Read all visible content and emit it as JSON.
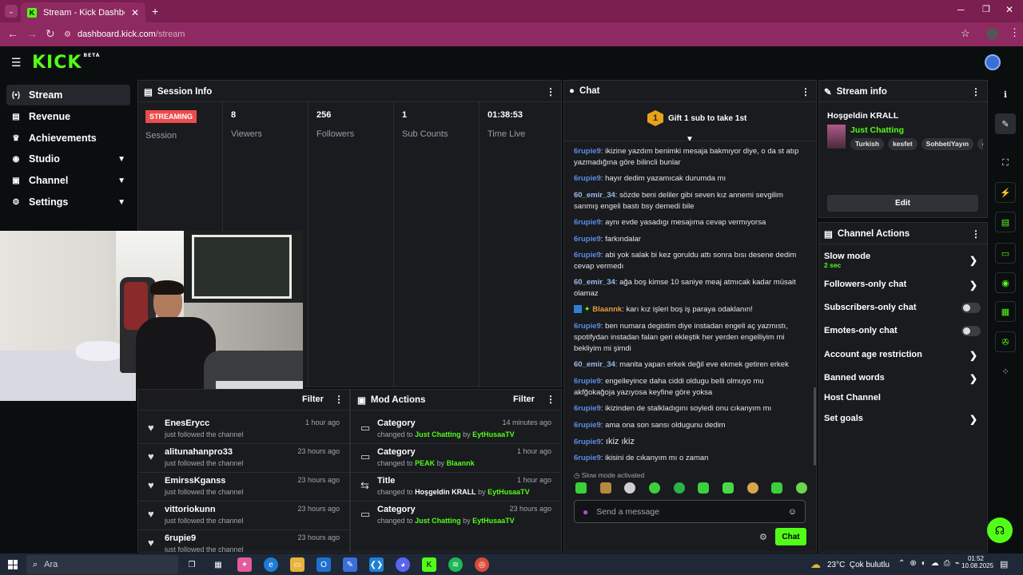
{
  "browser": {
    "tab_title": "Stream - Kick Dashboard",
    "url_host": "dashboard.kick.com",
    "url_path": "/stream"
  },
  "brand": {
    "logo": "KICK",
    "logo_sup": "BETA",
    "accent": "#53fc18"
  },
  "sidebar": {
    "items": [
      {
        "label": "Stream",
        "icon": "broadcast-icon"
      },
      {
        "label": "Revenue",
        "icon": "wallet-icon"
      },
      {
        "label": "Achievements",
        "icon": "trophy-icon"
      },
      {
        "label": "Studio",
        "icon": "studio-icon"
      },
      {
        "label": "Channel",
        "icon": "channel-icon"
      },
      {
        "label": "Settings",
        "icon": "gear-icon"
      }
    ]
  },
  "session": {
    "title": "Session Info",
    "status": "STREAMING",
    "status_label": "Session",
    "stats": [
      {
        "value": "8",
        "label": "Viewers"
      },
      {
        "value": "256",
        "label": "Followers"
      },
      {
        "value": "1",
        "label": "Sub Counts"
      },
      {
        "value": "01:38:53",
        "label": "Time Live"
      }
    ]
  },
  "followers": {
    "filter": "Filter",
    "rows": [
      {
        "name": "EnesErycc",
        "sub": "just followed the channel",
        "time": "1 hour ago"
      },
      {
        "name": "alitunahanpro33",
        "sub": "just followed the channel",
        "time": "23 hours ago"
      },
      {
        "name": "EmirssKganss",
        "sub": "just followed the channel",
        "time": "23 hours ago"
      },
      {
        "name": "vittoriokunn",
        "sub": "just followed the channel",
        "time": "23 hours ago"
      },
      {
        "name": "6rupie9",
        "sub": "just followed the channel",
        "time": "23 hours ago"
      }
    ]
  },
  "mod_actions": {
    "title": "Mod Actions",
    "filter": "Filter",
    "rows": [
      {
        "name": "Category",
        "pre": "changed to",
        "value": "Just Chatting",
        "by": "by",
        "who": "EytHusaaTV",
        "time": "14 minutes ago",
        "value_green": true
      },
      {
        "name": "Category",
        "pre": "changed to",
        "value": "PEAK",
        "by": "by",
        "who": "Blaannk",
        "time": "1 hour ago",
        "value_green": true
      },
      {
        "name": "Title",
        "pre": "changed to",
        "value": "Hoşgeldin KRALL",
        "by": "by",
        "who": "EytHusaaTV",
        "time": "1 hour ago",
        "value_green": false
      },
      {
        "name": "Category",
        "pre": "changed to",
        "value": "Just Chatting",
        "by": "by",
        "who": "EytHusaaTV",
        "time": "23 hours ago",
        "value_green": true
      }
    ]
  },
  "chat": {
    "title": "Chat",
    "gift_text": "Gift 1 sub to take 1st",
    "gift_rank": "1",
    "messages": [
      {
        "user": "6rupie9",
        "text": "ikizine yazdım benimki mesaja bakmıyor diye, o da st atıp yazmadığına göre bilincli bunlar"
      },
      {
        "user": "6rupie9",
        "text": "hayır dedim yazamıcak durumda mı"
      },
      {
        "user": "60_emir_34",
        "text": "sözde beni deliler gibi seven kız annemi sevgilim sanmış engeli bastı bsy demedi bile"
      },
      {
        "user": "6rupie9",
        "text": "aynı evde yasadıgı mesajıma cevap vermıyorsa"
      },
      {
        "user": "6rupie9",
        "text": "farkındalar"
      },
      {
        "user": "6rupie9",
        "text": "abi yok salak bi kez goruldu attı sonra bısı desene dedim cevap vermedı"
      },
      {
        "user": "60_emir_34",
        "text": "ağa boş kimse 10 saniye meaj atmıcak kadar müsait olamaz"
      },
      {
        "user": "Blaannk",
        "text": "karı kız işleri boş iş paraya odaklanın!"
      },
      {
        "user": "6rupie9",
        "text": "ben numara degistim diye instadan engeli aç yazmıstı, spotifydan instadan falan geri ekleştik her yerden engelliyim mi bekliyim mi şimdi"
      },
      {
        "user": "60_emir_34",
        "text": "manita yapan erkek değil eve ekmek getiren erkek"
      },
      {
        "user": "6rupie9",
        "text": "engelleyince daha ciddi oldugu belli olmuyo mu akfğokağoja yazıyosa keyfine göre yoksa"
      },
      {
        "user": "6rupie9",
        "text": "ikizinden de stalkladıgını soyledi onu cıkanyım mı"
      },
      {
        "user": "6rupie9",
        "text": "ama ona son sansı oldugunu dedim"
      },
      {
        "user": "6rupie9",
        "text": "ıkiz ıkiz"
      },
      {
        "user": "6rupie9",
        "text": "ikisini de cıkanyım mı o zaman"
      }
    ],
    "slow_mode": "Slow mode activated",
    "placeholder": "Send a message",
    "send": "Chat"
  },
  "stream_info": {
    "title": "Stream info",
    "stream_title": "Hoşgeldin KRALL",
    "category": "Just Chatting",
    "tags": [
      "Turkish",
      "kesfet",
      "SohbetiYayın",
      "e"
    ],
    "edit": "Edit"
  },
  "channel_actions": {
    "title": "Channel Actions",
    "slow_mode": "Slow mode",
    "slow_value": "2 sec",
    "items": [
      "Followers-only chat",
      "Subscribers-only chat",
      "Emotes-only chat",
      "Account age restriction",
      "Banned words",
      "Host Channel",
      "Set goals"
    ]
  },
  "taskbar": {
    "search": "Ara",
    "weather": "23°C  Çok bulutlu",
    "time": "01:52",
    "date": "10.08.2025"
  }
}
